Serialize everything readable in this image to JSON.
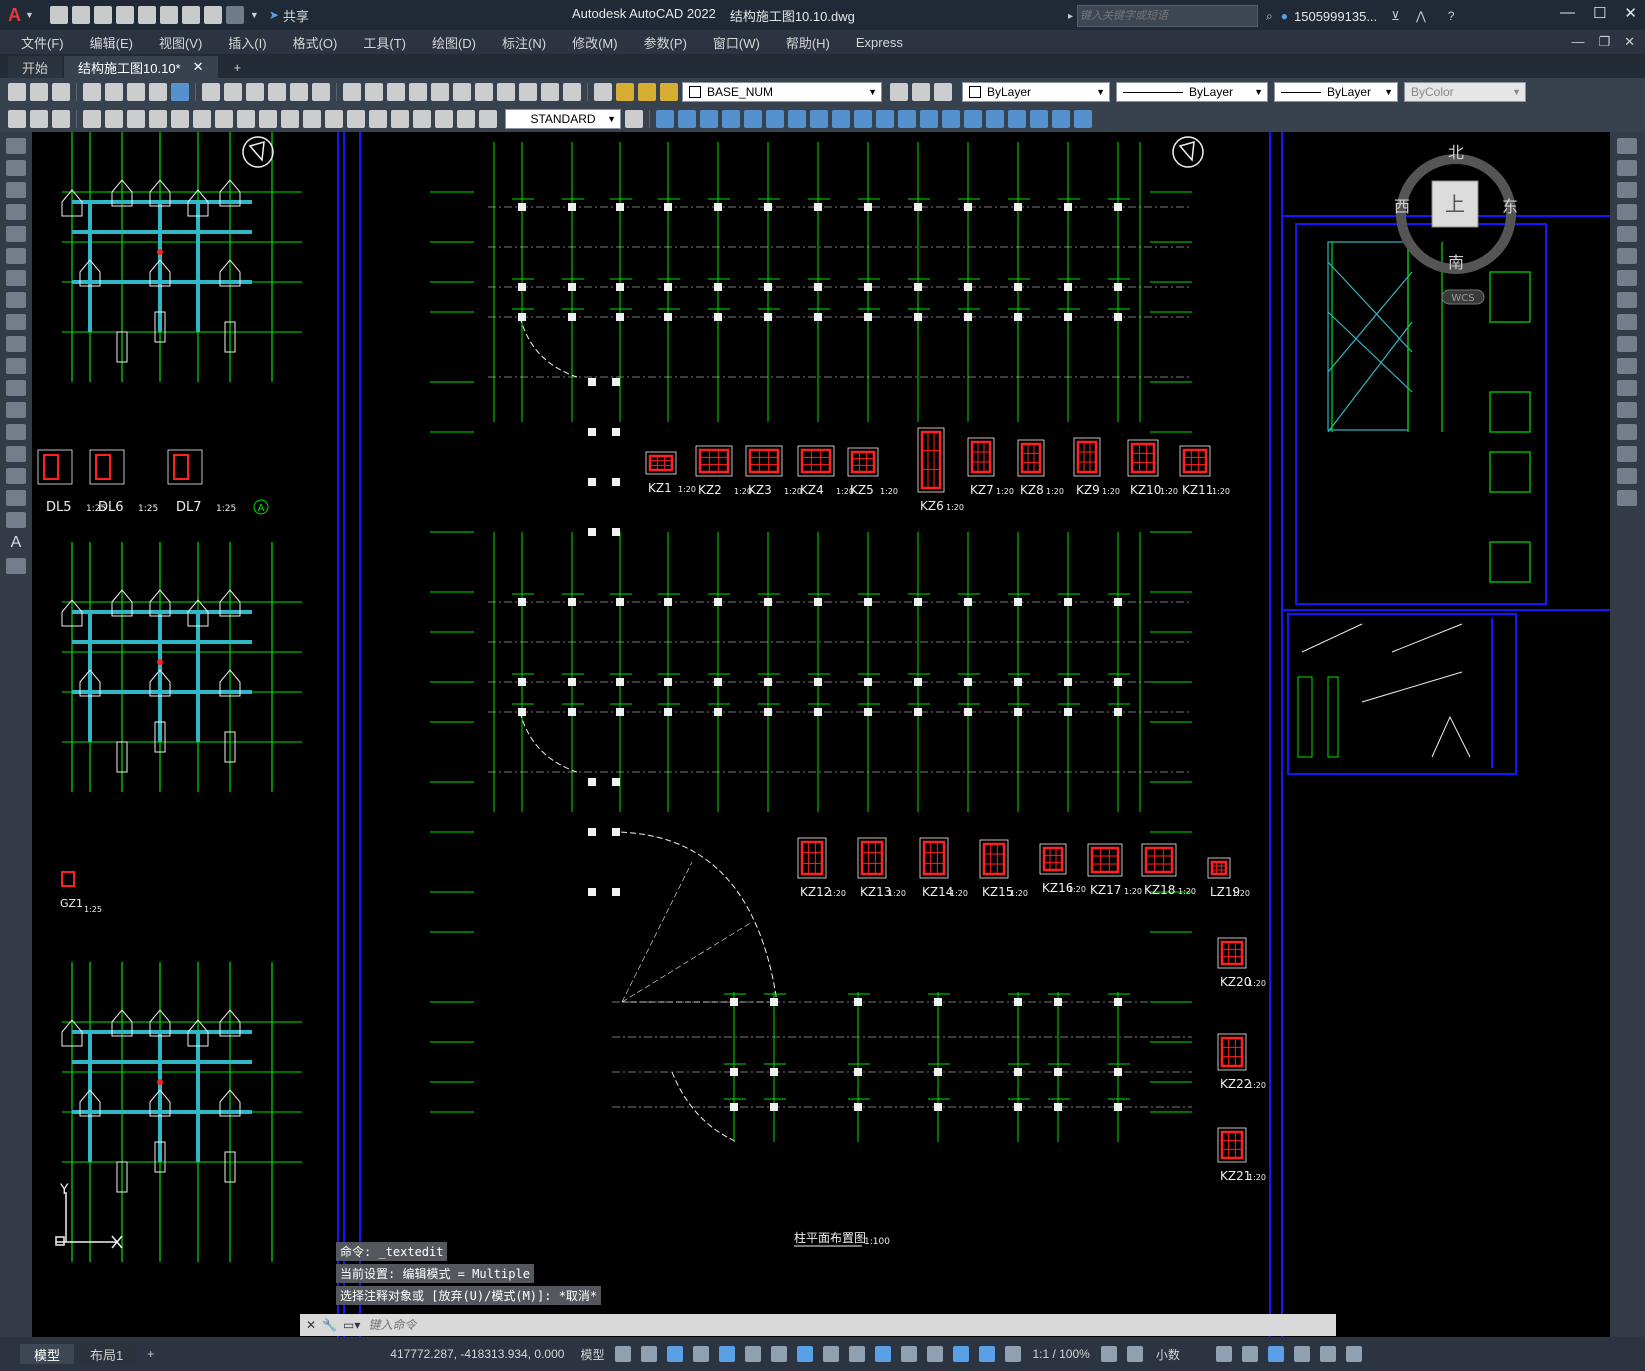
{
  "app": {
    "title": "Autodesk AutoCAD 2022",
    "filename": "结构施工图10.10.dwg",
    "share_label": "共享",
    "search_placeholder": "键入关键字或短语",
    "user": "1505999135..."
  },
  "menu": [
    "文件(F)",
    "编辑(E)",
    "视图(V)",
    "插入(I)",
    "格式(O)",
    "工具(T)",
    "绘图(D)",
    "标注(N)",
    "修改(M)",
    "参数(P)",
    "窗口(W)",
    "帮助(H)",
    "Express"
  ],
  "tabs": [
    {
      "label": "开始",
      "active": false
    },
    {
      "label": "结构施工图10.10*",
      "active": true
    }
  ],
  "toolbar": {
    "layer": "BASE_NUM",
    "color": "ByLayer",
    "linetype": "ByLayer",
    "lineweight": "ByLayer",
    "plotstyle": "ByColor",
    "textstyle": "STANDARD"
  },
  "viewcube": {
    "north": "北",
    "south": "南",
    "east": "东",
    "west": "西",
    "top": "上",
    "wcs": "WCS"
  },
  "drawing": {
    "dl_labels": [
      {
        "name": "DL5",
        "scale": "1:25"
      },
      {
        "name": "DL6",
        "scale": "1:25"
      },
      {
        "name": "DL7",
        "scale": "1:25"
      }
    ],
    "dl_marker": "A",
    "gz1": {
      "name": "GZ1",
      "scale": "1:25"
    },
    "kz_row1": [
      {
        "name": "KZ1",
        "scale": "1:20"
      },
      {
        "name": "KZ2",
        "scale": "1:20"
      },
      {
        "name": "KZ3",
        "scale": "1:20"
      },
      {
        "name": "KZ4",
        "scale": "1:20"
      },
      {
        "name": "KZ5",
        "scale": "1:20"
      },
      {
        "name": "KZ6",
        "scale": "1:20"
      },
      {
        "name": "KZ7",
        "scale": "1:20"
      },
      {
        "name": "KZ8",
        "scale": "1:20"
      },
      {
        "name": "KZ9",
        "scale": "1:20"
      },
      {
        "name": "KZ10",
        "scale": "1:20"
      },
      {
        "name": "KZ11",
        "scale": "1:20"
      }
    ],
    "kz_row2": [
      {
        "name": "KZ12",
        "scale": "1:20"
      },
      {
        "name": "KZ13",
        "scale": "1:20"
      },
      {
        "name": "KZ14",
        "scale": "1:20"
      },
      {
        "name": "KZ15",
        "scale": "1:20"
      },
      {
        "name": "KZ16",
        "scale": "1:20"
      },
      {
        "name": "KZ17",
        "scale": "1:20"
      },
      {
        "name": "KZ18",
        "scale": "1:20"
      },
      {
        "name": "LZ19",
        "scale": "1:20"
      }
    ],
    "kz_right": [
      {
        "name": "KZ20",
        "scale": "1:20"
      },
      {
        "name": "KZ22",
        "scale": "1:20"
      },
      {
        "name": "KZ21",
        "scale": "1:20"
      }
    ],
    "plan_title": "柱平面布置图",
    "plan_scale": "1:100",
    "axis_y": "Y"
  },
  "command": {
    "history": [
      "命令: _textedit",
      "当前设置: 编辑模式 = Multiple",
      "选择注释对象或 [放弃(U)/模式(M)]: *取消*"
    ],
    "placeholder": "键入命令"
  },
  "layout_tabs": [
    "模型",
    "布局1"
  ],
  "status": {
    "coords": "417772.287, -418313.934, 0.000",
    "mode": "模型",
    "scale": "1:1 / 100%",
    "units": "小数"
  },
  "colors": {
    "green": "#00e000",
    "blue": "#1010ff",
    "cyan": "#2fb7c8",
    "red": "#ff2020",
    "white": "#f0f0f0"
  }
}
